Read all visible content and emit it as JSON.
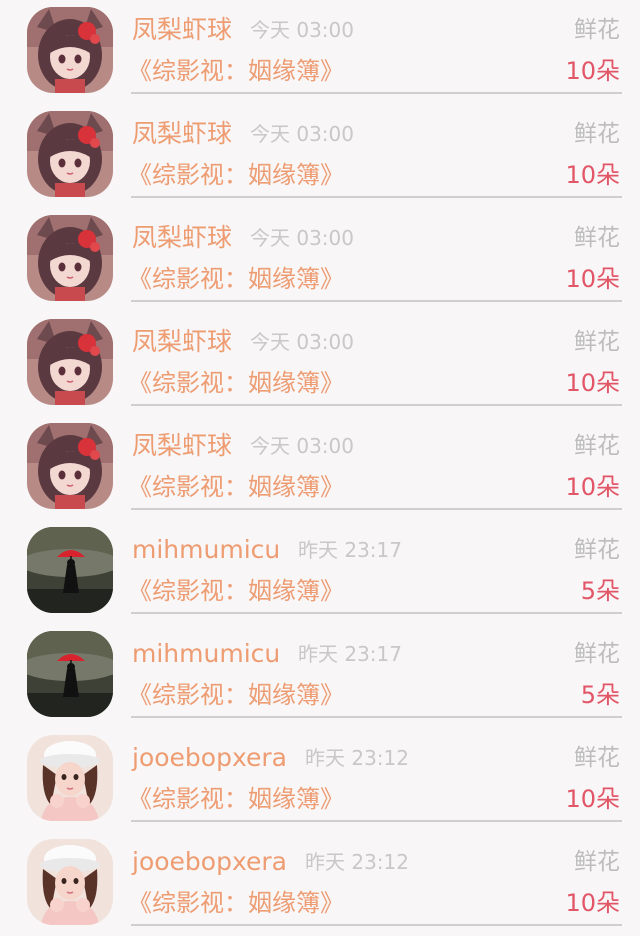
{
  "colors": {
    "name": "#ee9c72",
    "time": "#c8c8c8",
    "gift": "#bdbdbd",
    "book": "#ee9c72",
    "count": "#e25668",
    "divider": "#cfcfcf"
  },
  "rows": [
    {
      "avatar": "anime-girl-icon",
      "name": "凤梨虾球",
      "time": "今天 03:00",
      "gift": "鲜花",
      "book": "《综影视：姻缘簿》",
      "count": "10朵"
    },
    {
      "avatar": "anime-girl-icon",
      "name": "凤梨虾球",
      "time": "今天 03:00",
      "gift": "鲜花",
      "book": "《综影视：姻缘簿》",
      "count": "10朵"
    },
    {
      "avatar": "anime-girl-icon",
      "name": "凤梨虾球",
      "time": "今天 03:00",
      "gift": "鲜花",
      "book": "《综影视：姻缘簿》",
      "count": "10朵"
    },
    {
      "avatar": "anime-girl-icon",
      "name": "凤梨虾球",
      "time": "今天 03:00",
      "gift": "鲜花",
      "book": "《综影视：姻缘簿》",
      "count": "10朵"
    },
    {
      "avatar": "anime-girl-icon",
      "name": "凤梨虾球",
      "time": "今天 03:00",
      "gift": "鲜花",
      "book": "《综影视：姻缘簿》",
      "count": "10朵"
    },
    {
      "avatar": "red-umbrella-icon",
      "name": "mihmumicu",
      "time": "昨天 23:17",
      "gift": "鲜花",
      "book": "《综影视：姻缘簿》",
      "count": "5朵"
    },
    {
      "avatar": "red-umbrella-icon",
      "name": "mihmumicu",
      "time": "昨天 23:17",
      "gift": "鲜花",
      "book": "《综影视：姻缘簿》",
      "count": "5朵"
    },
    {
      "avatar": "girl-white-hat-icon",
      "name": "jooebopxera",
      "time": "昨天 23:12",
      "gift": "鲜花",
      "book": "《综影视：姻缘簿》",
      "count": "10朵"
    },
    {
      "avatar": "girl-white-hat-icon",
      "name": "jooebopxera",
      "time": "昨天 23:12",
      "gift": "鲜花",
      "book": "《综影视：姻缘簿》",
      "count": "10朵"
    }
  ]
}
